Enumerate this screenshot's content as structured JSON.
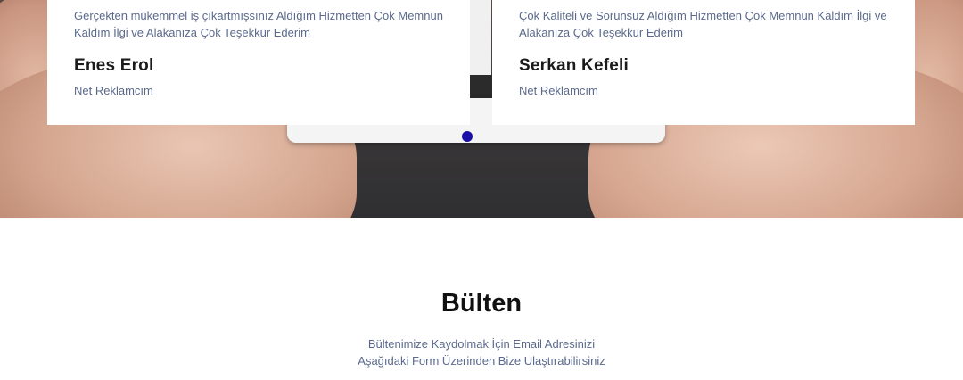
{
  "testimonials": {
    "items": [
      {
        "quote": "Gerçekten mükemmel iş çıkartmışsınız Aldığım Hizmetten Çok Memnun Kaldım İlgi ve Alakanıza Çok Teşekkür Ederim",
        "name": "Enes Erol",
        "role": "Net Reklamcım"
      },
      {
        "quote": "Çok Kaliteli ve Sorunsuz Aldığım Hizmetten Çok Memnun Kaldım İlgi ve Alakanıza Çok Teşekkür Ederim",
        "name": "Serkan Kefeli",
        "role": "Net Reklamcım"
      }
    ],
    "active_dot_color": "#1a10a8"
  },
  "newsletter": {
    "title": "Bülten",
    "description_line1": "Bültenimize Kaydolmak İçin Email Adresinizi",
    "description_line2": "Aşağıdaki Form Üzerinden Bize Ulaştırabilirsiniz"
  }
}
